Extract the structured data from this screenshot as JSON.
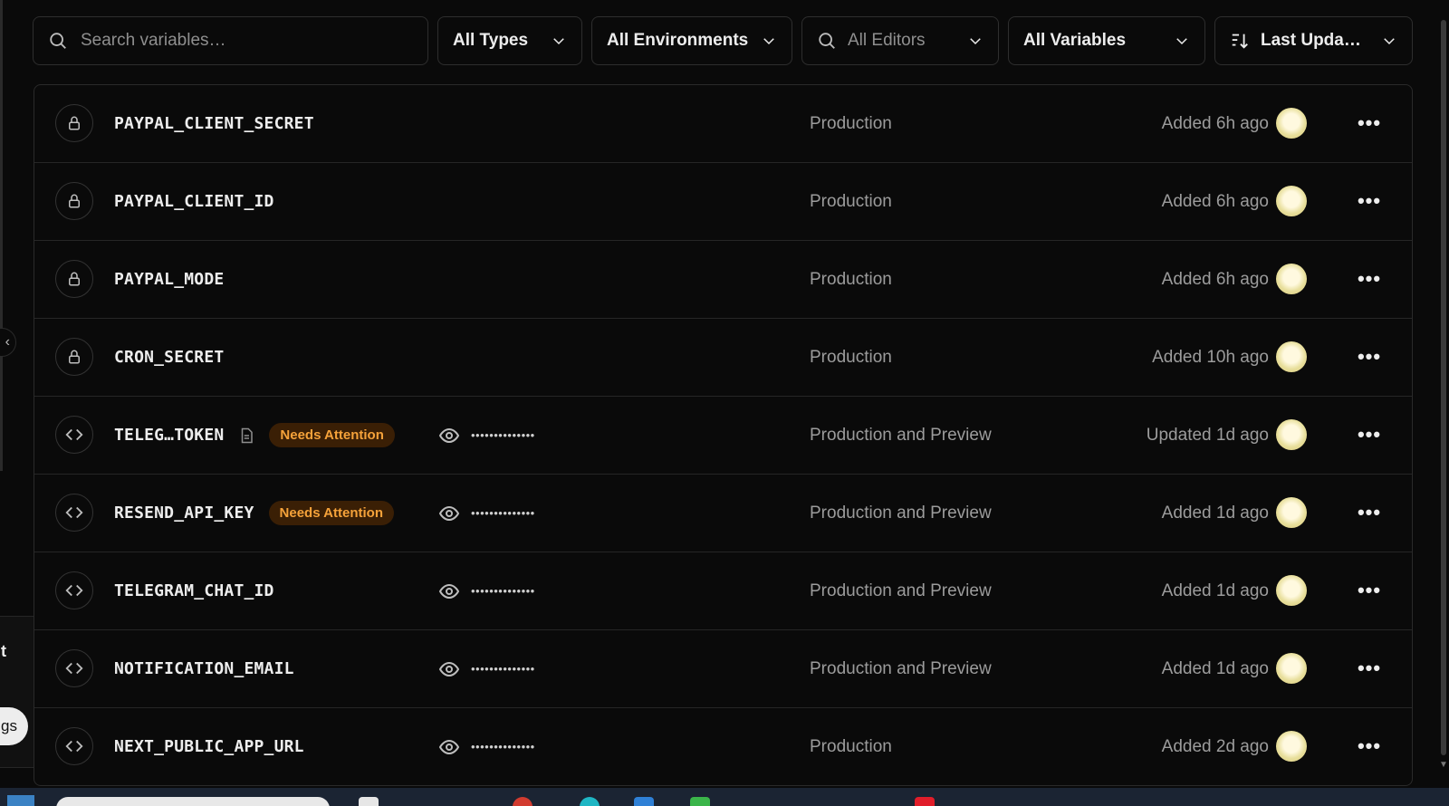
{
  "filters": {
    "search_placeholder": "Search variables…",
    "types": "All Types",
    "environments": "All Environments",
    "editors": "All Editors",
    "variables": "All Variables",
    "sort": "Last Upda…"
  },
  "variables": [
    {
      "name": "PAYPAL_CLIENT_SECRET",
      "icon": "lock-icon",
      "badge": "",
      "masked": "",
      "environment": "Production",
      "updated": "Added 6h ago"
    },
    {
      "name": "PAYPAL_CLIENT_ID",
      "icon": "lock-icon",
      "badge": "",
      "masked": "",
      "environment": "Production",
      "updated": "Added 6h ago"
    },
    {
      "name": "PAYPAL_MODE",
      "icon": "lock-icon",
      "badge": "",
      "masked": "",
      "environment": "Production",
      "updated": "Added 6h ago"
    },
    {
      "name": "CRON_SECRET",
      "icon": "lock-icon",
      "badge": "",
      "masked": "",
      "environment": "Production",
      "updated": "Added 10h ago"
    },
    {
      "name": "TELEG…TOKEN",
      "icon": "code-icon",
      "note_icon": "document-icon",
      "badge": "Needs Attention",
      "masked": "••••••••••••••",
      "environment": "Production and Preview",
      "updated": "Updated 1d ago"
    },
    {
      "name": "RESEND_API_KEY",
      "icon": "code-icon",
      "badge": "Needs Attention",
      "masked": "••••••••••••••",
      "environment": "Production and Preview",
      "updated": "Added 1d ago"
    },
    {
      "name": "TELEGRAM_CHAT_ID",
      "icon": "code-icon",
      "badge": "",
      "masked": "••••••••••••••",
      "environment": "Production and Preview",
      "updated": "Added 1d ago"
    },
    {
      "name": "NOTIFICATION_EMAIL",
      "icon": "code-icon",
      "badge": "",
      "masked": "••••••••••••••",
      "environment": "Production and Preview",
      "updated": "Added 1d ago"
    },
    {
      "name": "NEXT_PUBLIC_APP_URL",
      "icon": "code-icon",
      "badge": "",
      "masked": "••••••••••••••",
      "environment": "Production",
      "updated": "Added 2d ago"
    }
  ],
  "side_popover": {
    "partial_text": "t",
    "partial_button": "gs"
  },
  "colors": {
    "background": "#0a0a0a",
    "border": "#2a2a2a",
    "badge_bg": "#3a1f05",
    "badge_text": "#f5a23a"
  }
}
